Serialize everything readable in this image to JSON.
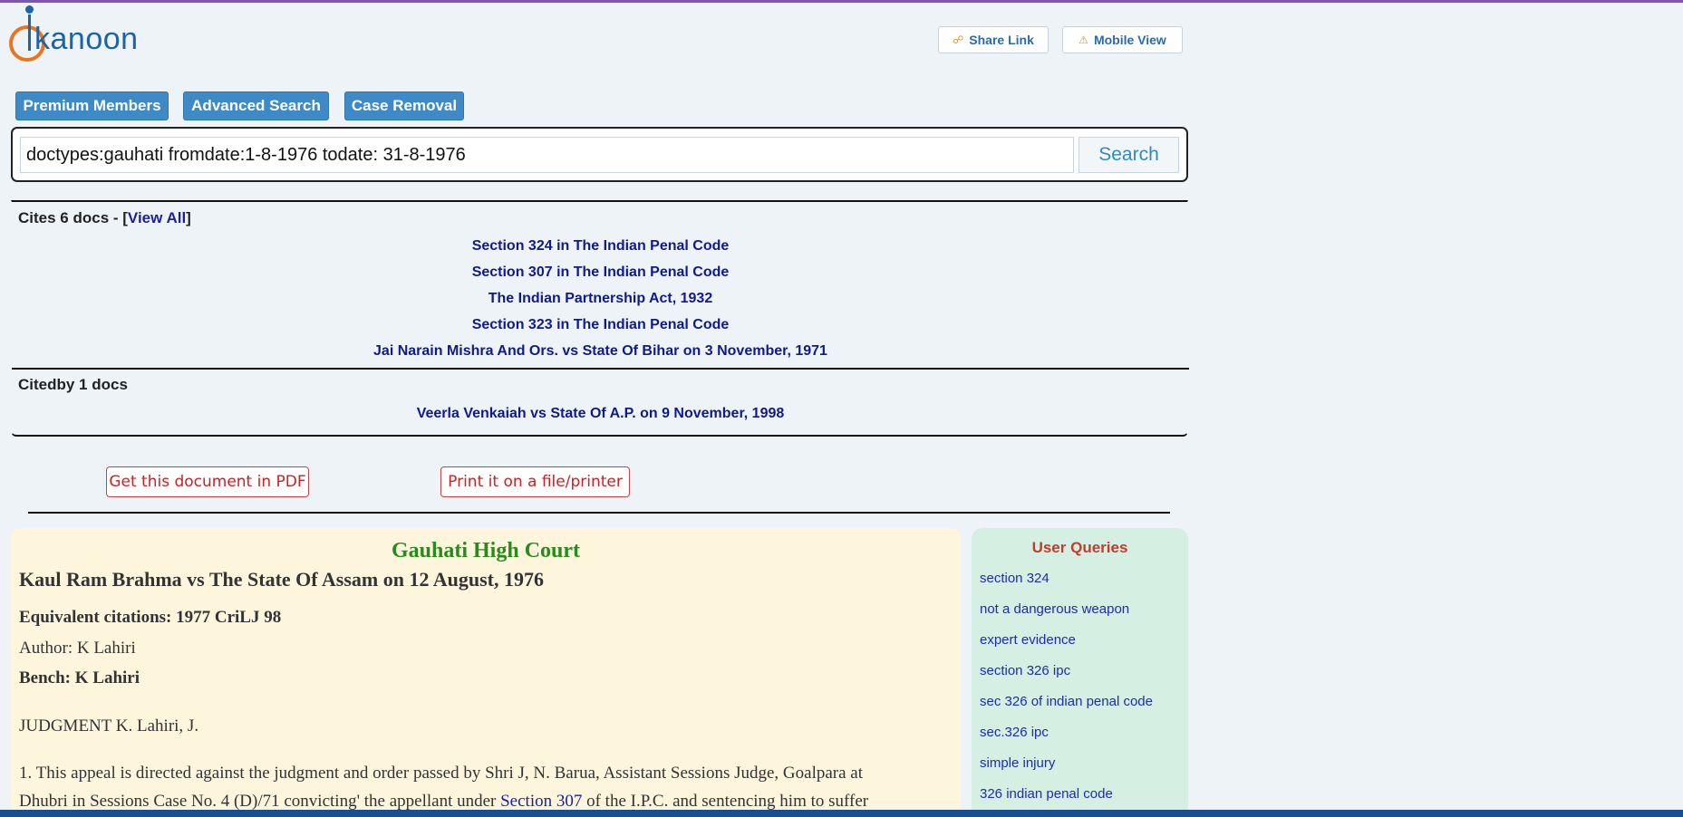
{
  "header": {
    "logo_text": "kanoon",
    "share_label": "Share Link",
    "mobile_label": "Mobile View"
  },
  "nav": {
    "premium": "Premium Members",
    "advanced": "Advanced Search",
    "removal": "Case Removal"
  },
  "search": {
    "query": "doctypes:gauhati fromdate:1-8-1976 todate: 31-8-1976",
    "button": "Search"
  },
  "cites": {
    "label": "Cites 6 docs - [",
    "view_all": "View All",
    "close": "]",
    "items": [
      "Section 324 in The Indian Penal Code",
      "Section 307 in The Indian Penal Code",
      "The Indian Partnership Act, 1932",
      "Section 323 in The Indian Penal Code",
      "Jai Narain Mishra And Ors. vs State Of Bihar on 3 November, 1971"
    ]
  },
  "citedby": {
    "label": "Citedby 1 docs",
    "items": [
      "Veerla Venkaiah vs State Of A.P. on 9 November, 1998"
    ]
  },
  "actions": {
    "pdf": "Get this document in PDF",
    "print": "Print it on a file/printer"
  },
  "judgment": {
    "court": "Gauhati High Court",
    "title": "Kaul Ram Brahma vs The State Of Assam on 12 August, 1976",
    "equivalent": "Equivalent citations: 1977 CriLJ 98",
    "author": "Author: K Lahiri",
    "bench": "Bench: K Lahiri",
    "judgment_line": "JUDGMENT K. Lahiri, J.",
    "para1": "1. This appeal is directed against the judgment and order passed by Shri J, N. Barua, Assistant Sessions Judge, Goalpara at",
    "para2_before": "Dhubri in Sessions Case No. 4 (D)/71 convicting' the appellant under ",
    "para2_link": "Section 307",
    "para2_after": " of the I.P.C. and sentencing him to suffer"
  },
  "queries": {
    "title": "User Queries",
    "items": [
      "section 324",
      "not a dangerous weapon",
      "expert evidence",
      "section 326 ipc",
      "sec 326 of indian penal code",
      "sec.326 ipc",
      "simple injury",
      "326 indian penal code"
    ]
  }
}
